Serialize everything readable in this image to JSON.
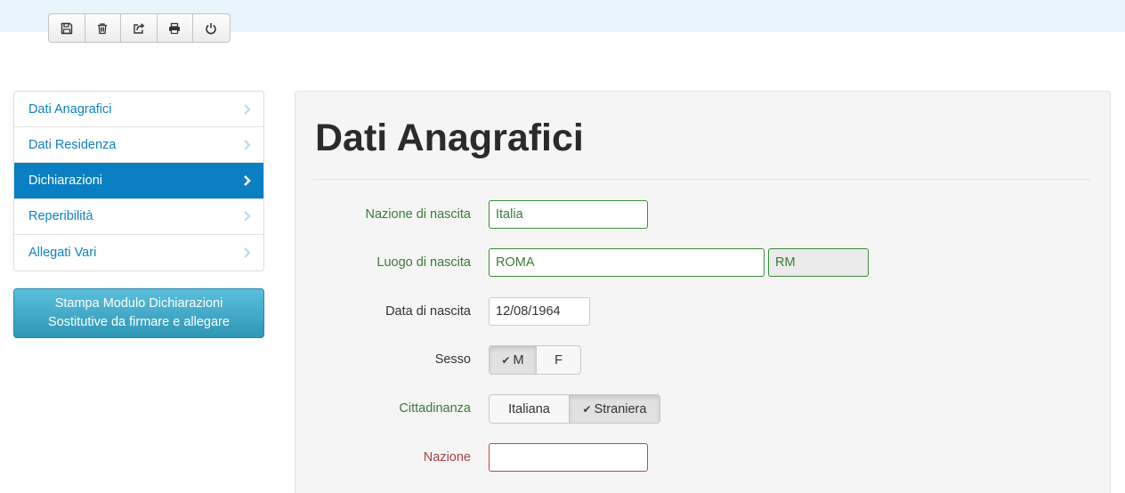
{
  "toolbar": {
    "buttons": [
      {
        "name": "save-button",
        "icon": "floppy-disk-icon"
      },
      {
        "name": "delete-button",
        "icon": "trash-icon"
      },
      {
        "name": "share-button",
        "icon": "share-icon"
      },
      {
        "name": "print-button",
        "icon": "printer-icon"
      },
      {
        "name": "logout-button",
        "icon": "power-icon"
      }
    ]
  },
  "sidebar": {
    "items": [
      {
        "label": "Dati Anagrafici",
        "active": false
      },
      {
        "label": "Dati Residenza",
        "active": false
      },
      {
        "label": "Dichiarazioni",
        "active": true
      },
      {
        "label": "Reperibilità",
        "active": false
      },
      {
        "label": "Allegati Vari",
        "active": false
      }
    ],
    "print_button_line1": "Stampa Modulo Dichiarazioni",
    "print_button_line2": "Sostitutive da firmare e allegare"
  },
  "form": {
    "title": "Dati Anagrafici",
    "nazione_nascita": {
      "label": "Nazione di nascita",
      "value": "Italia"
    },
    "luogo_nascita": {
      "label": "Luogo di nascita",
      "value": "ROMA",
      "provincia": "RM"
    },
    "data_nascita": {
      "label": "Data di nascita",
      "value": "12/08/1964"
    },
    "sesso": {
      "label": "Sesso",
      "options": [
        "M",
        "F"
      ],
      "selected": "M"
    },
    "cittadinanza": {
      "label": "Cittadinanza",
      "options": [
        "Italiana",
        "Straniera"
      ],
      "selected": "Straniera"
    },
    "nazione": {
      "label": "Nazione",
      "value": ""
    }
  },
  "colors": {
    "accent": "#0a7fc3",
    "valid": "#3c7a3d",
    "error": "#a94442",
    "print_button": "#3ea9c9"
  }
}
